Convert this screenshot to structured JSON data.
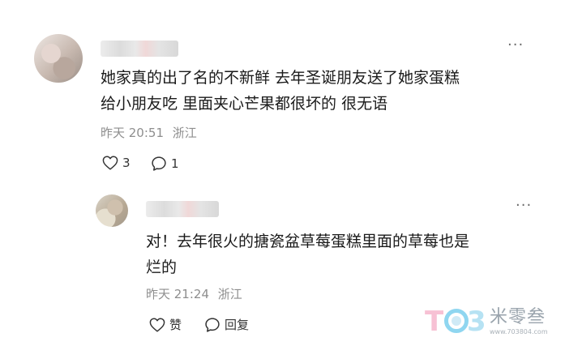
{
  "comment": {
    "text_lines": [
      "她家真的出了名的不新鲜 去年圣诞朋友送了她家蛋糕",
      "给小朋友吃 里面夹心芒果都很坏的 很无语"
    ],
    "time": "昨天 20:51",
    "location": "浙江",
    "like_count": "3",
    "reply_count": "1",
    "more_glyph": "···"
  },
  "reply": {
    "text_lines": [
      "对！去年很火的搪瓷盆草莓蛋糕里面的草莓也是",
      "烂的"
    ],
    "time": "昨天 21:24",
    "location": "浙江",
    "like_label": "赞",
    "reply_label": "回复",
    "more_glyph": "···"
  },
  "watermark": {
    "logo_glyphs": [
      "T",
      "3"
    ],
    "name": "米零叁",
    "url": "www.703804.com"
  },
  "icons": {
    "like": "heart-outline-icon",
    "reply": "comment-bubble-icon",
    "more": "more-dots-icon"
  },
  "colors": {
    "text": "#1a1a1a",
    "meta": "#8e8e8e",
    "icon": "#333333"
  }
}
